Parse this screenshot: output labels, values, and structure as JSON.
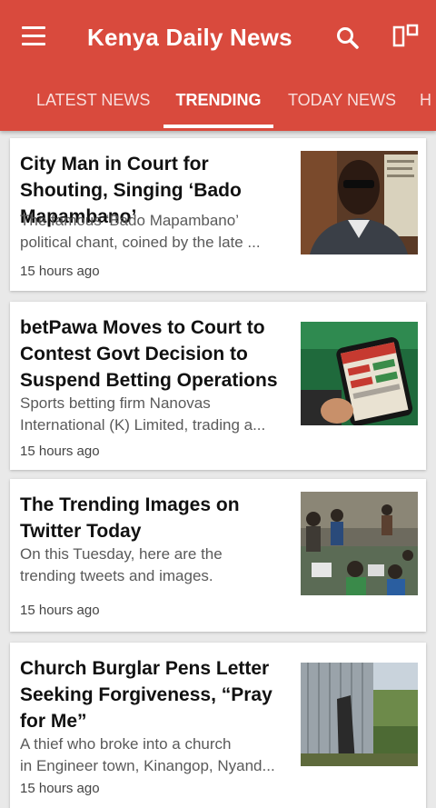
{
  "app": {
    "title": "Kenya Daily News"
  },
  "tabs": [
    {
      "label": "LATEST NEWS"
    },
    {
      "label": "TRENDING"
    },
    {
      "label": "TODAY NEWS"
    },
    {
      "label": "H"
    }
  ],
  "active_tab": "TRENDING",
  "colors": {
    "app_bar": "#d94a3d",
    "background": "#e9e9e9"
  },
  "articles": [
    {
      "title": "City Man in Court for Shouting, Singing ‘Bado Mapambano’",
      "description_line1": "The famous ‘Bado Mapambano’",
      "description_line2": "political chant, coined by the late ...",
      "time": "15 hours ago",
      "thumbnail": "man-in-court-photo"
    },
    {
      "title": "betPawa Moves to Court to Contest Govt Decision to Suspend Betting Operations",
      "description_line1": "Sports betting firm Nanovas",
      "description_line2": "International (K) Limited, trading a...",
      "time": "15 hours ago",
      "thumbnail": "betting-phone-photo"
    },
    {
      "title": "The Trending Images on Twitter Today",
      "description_line1": "On this Tuesday, here are the",
      "description_line2": "trending tweets and images.",
      "time": "15 hours ago",
      "thumbnail": "crowd-gathering-photo"
    },
    {
      "title": "Church Burglar Pens Letter Seeking Forgiveness, “Pray for Me”",
      "description_line1": "A thief who broke into a church",
      "description_line2": "in Engineer town, Kinangop, Nyand...",
      "time": "15 hours ago",
      "thumbnail": "iron-sheet-church-photo"
    }
  ]
}
